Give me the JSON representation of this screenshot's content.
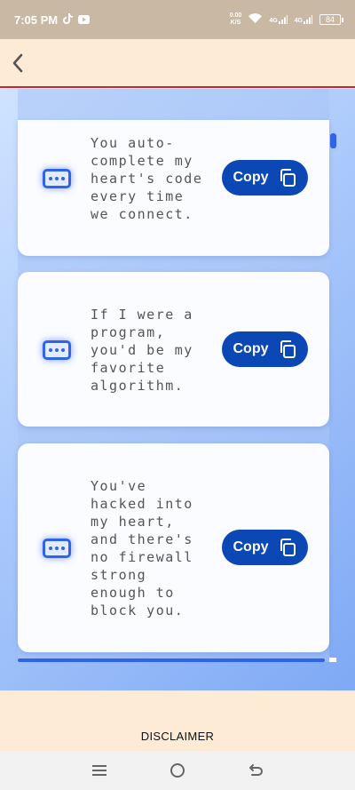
{
  "status_bar": {
    "time": "7:05 PM",
    "net_speed_top": "0.00",
    "net_speed_bottom": "K/S",
    "signal_1": "4G",
    "signal_2": "4G",
    "battery": "84"
  },
  "app_bar": {
    "back_icon": "chevron-left-icon"
  },
  "cards": [
    {
      "text": "You auto-complete my heart's code every time we connect.",
      "copy_label": "Copy"
    },
    {
      "text": "If I were a program, you'd be my favorite algorithm.",
      "copy_label": "Copy"
    },
    {
      "text": "You've hacked into my heart, and there's no firewall strong enough to block you.",
      "copy_label": "Copy"
    }
  ],
  "footer": {
    "disclaimer": "DISCLAIMER"
  },
  "nav_bar": {
    "recents_icon": "menu-icon",
    "home_icon": "circle-home-icon",
    "back_icon": "back-arrow-icon"
  },
  "colors": {
    "accent": "#0b48b5",
    "icon_blue": "#2f63ea",
    "header_bg": "#fdebd6",
    "status_bg": "#c9b8a3",
    "divider_red": "#d71f2a"
  }
}
